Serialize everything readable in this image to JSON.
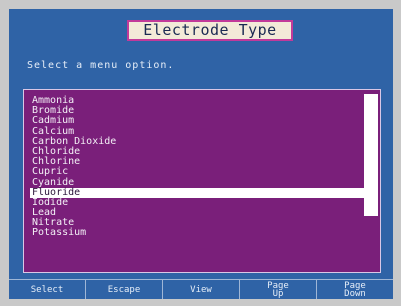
{
  "window": {
    "title": "Electrode Type"
  },
  "prompt": "Select a menu option.",
  "menu": {
    "items": [
      "Ammonia",
      "Bromide",
      "Cadmium",
      "Calcium",
      "Carbon Dioxide",
      "Chloride",
      "Chlorine",
      "Cupric",
      "Cyanide",
      "Fluoride",
      "Iodide",
      "Lead",
      "Nitrate",
      "Potassium"
    ],
    "selected_index": 9
  },
  "function_keys": [
    {
      "label": "Select"
    },
    {
      "label": "Escape"
    },
    {
      "label": "View"
    },
    {
      "label": "Page\nUp"
    },
    {
      "label": "Page\nDown"
    }
  ],
  "colors": {
    "screen_bg": "#2f63a6",
    "list_bg": "#7a1f7a",
    "title_border": "#c23a9a",
    "selection_bg": "#ffffff"
  }
}
